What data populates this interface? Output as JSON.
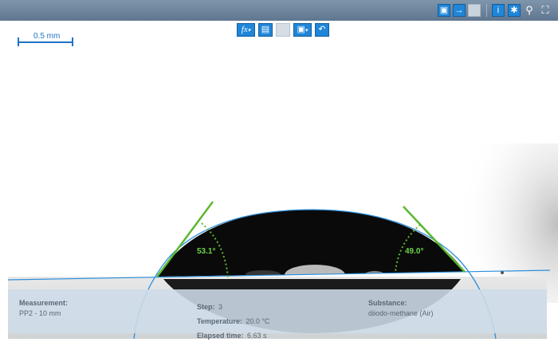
{
  "toolbar_top": {
    "icons": [
      "save-icon",
      "arrow-right-icon",
      "image-icon",
      "info-icon",
      "gear-icon",
      "zoom-icon",
      "fit-screen-icon"
    ]
  },
  "toolbar_main": {
    "fx_label": "fx",
    "icons": [
      "function-icon",
      "data-table-icon",
      "image-copy-icon",
      "save-options-icon",
      "undo-icon"
    ]
  },
  "scale_bar": {
    "label": "0.5 mm"
  },
  "angles": {
    "left": "53.1°",
    "right": "49.0°"
  },
  "colors": {
    "accent_blue": "#1e73c6",
    "tangent_green": "#5cb82e",
    "angle_text": "#6cd34a",
    "toolbar_bg": "#6b829b"
  },
  "info": {
    "measurement_key": "Measurement:",
    "measurement_val": "PP2 - 10 mm",
    "step_key": "Step:",
    "step_val": "3",
    "temperature_key": "Temperature:",
    "temperature_val": "20.0 °C",
    "elapsed_key": "Elapsed time:",
    "elapsed_val": "6.63 s",
    "substance_key": "Substance:",
    "substance_val": "diiodo-methane (Air)"
  }
}
